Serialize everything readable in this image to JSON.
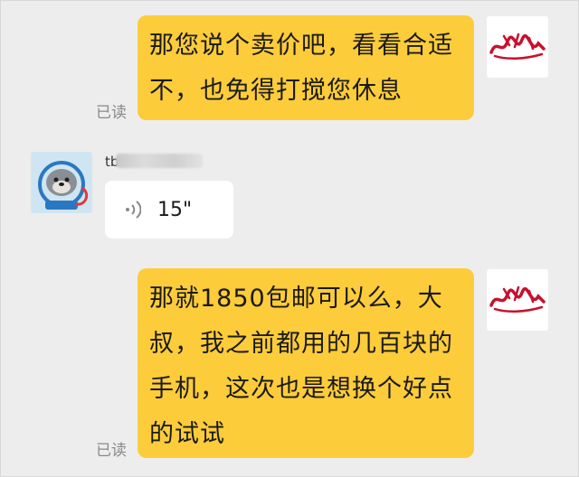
{
  "messages": [
    {
      "type": "outgoing_text",
      "text": "那您说个卖价吧，看看合适\n不，也免得打搅您休息",
      "status": "已读",
      "avatar": "red-signature-logo"
    },
    {
      "type": "incoming_voice",
      "sender": "tb",
      "duration": "15\"",
      "icon": "voice-waves-icon",
      "avatar": "otter-astronaut-avatar"
    },
    {
      "type": "outgoing_text",
      "text": "那就1850包邮可以么，大\n叔，我之前都用的几百块的\n手机，这次也是想换个好点\n的试试",
      "status": "已读",
      "avatar": "red-signature-logo"
    }
  ],
  "colors": {
    "background": "#ededed",
    "outgoing_bubble": "#fccc3a",
    "incoming_bubble": "#ffffff",
    "read_label": "#8a8a8a"
  }
}
